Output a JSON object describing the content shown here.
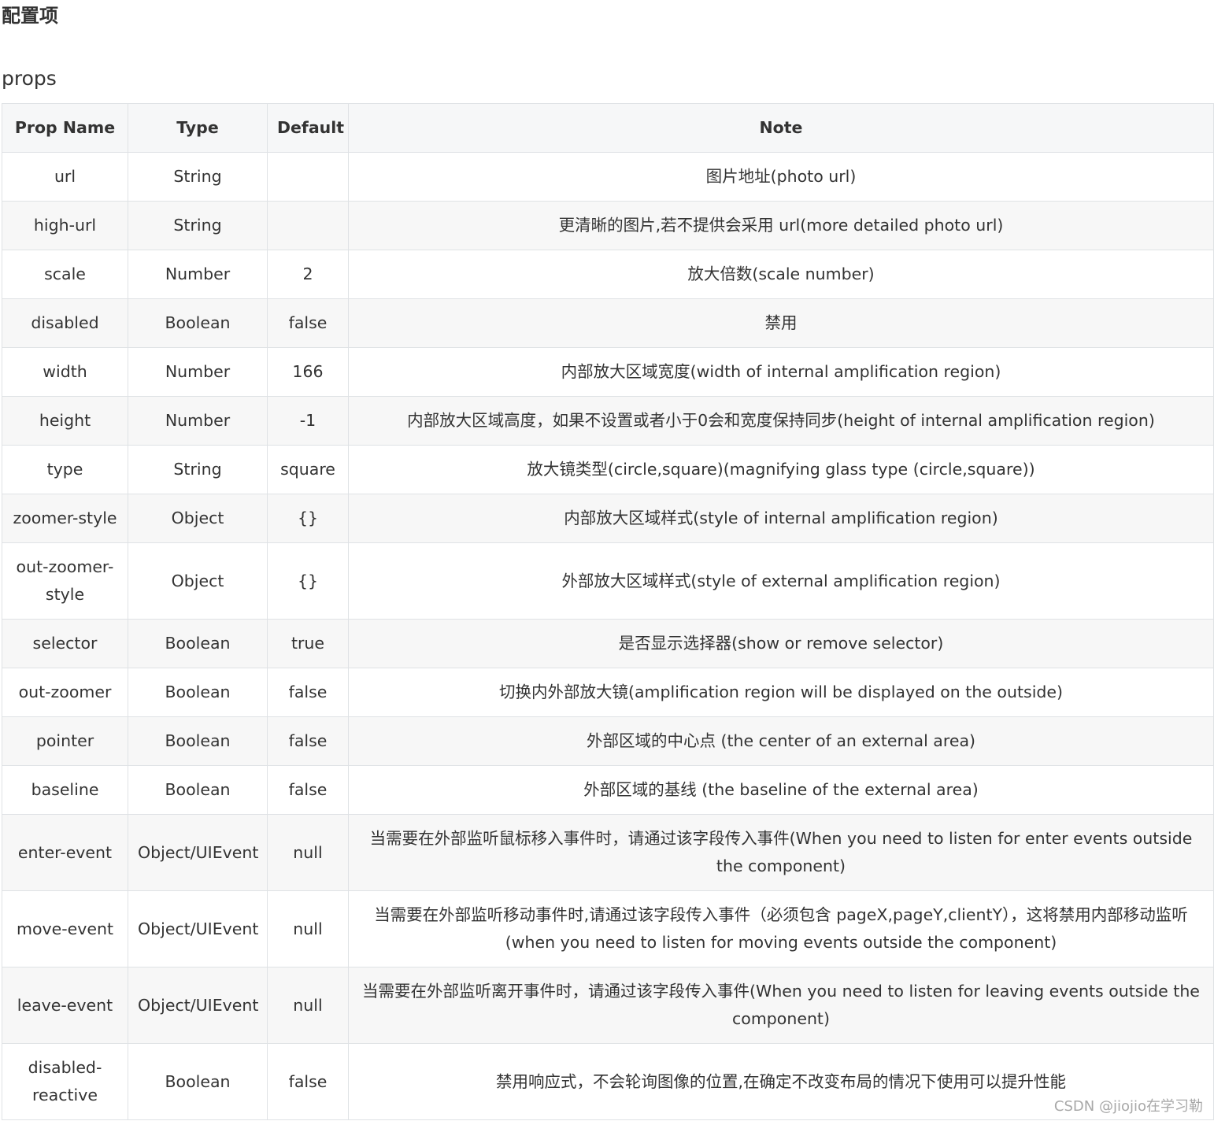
{
  "page_title": "配置项",
  "section_title": "props",
  "table": {
    "headers": [
      "Prop Name",
      "Type",
      "Default",
      "Note"
    ],
    "rows": [
      [
        "url",
        "String",
        "",
        "图片地址(photo url)"
      ],
      [
        "high-url",
        "String",
        "",
        "更清晰的图片,若不提供会采用 url(more detailed photo url)"
      ],
      [
        "scale",
        "Number",
        "2",
        "放大倍数(scale number)"
      ],
      [
        "disabled",
        "Boolean",
        "false",
        "禁用"
      ],
      [
        "width",
        "Number",
        "166",
        "内部放大区域宽度(width of internal amplification region)"
      ],
      [
        "height",
        "Number",
        "-1",
        "内部放大区域高度，如果不设置或者小于0会和宽度保持同步(height of internal amplification region)"
      ],
      [
        "type",
        "String",
        "square",
        "放大镜类型(circle,square)(magnifying glass type (circle,square))"
      ],
      [
        "zoomer-style",
        "Object",
        "{}",
        "内部放大区域样式(style of internal amplification region)"
      ],
      [
        "out-zoomer-style",
        "Object",
        "{}",
        "外部放大区域样式(style of external amplification region)"
      ],
      [
        "selector",
        "Boolean",
        "true",
        "是否显示选择器(show or remove selector)"
      ],
      [
        "out-zoomer",
        "Boolean",
        "false",
        "切换内外部放大镜(amplification region will be displayed on the outside)"
      ],
      [
        "pointer",
        "Boolean",
        "false",
        "外部区域的中心点 (the center of an external area)"
      ],
      [
        "baseline",
        "Boolean",
        "false",
        "外部区域的基线 (the baseline of the external area)"
      ],
      [
        "enter-event",
        "Object/UIEvent",
        "null",
        "当需要在外部监听鼠标移入事件时，请通过该字段传入事件(When you need to listen for enter events outside the component)"
      ],
      [
        "move-event",
        "Object/UIEvent",
        "null",
        "当需要在外部监听移动事件时,请通过该字段传入事件（必须包含 pageX,pageY,clientY），这将禁用内部移动监听(when you need to listen for moving events outside the component)"
      ],
      [
        "leave-event",
        "Object/UIEvent",
        "null",
        "当需要在外部监听离开事件时，请通过该字段传入事件(When you need to listen for leaving events outside the component)"
      ],
      [
        "disabled-reactive",
        "Boolean",
        "false",
        "禁用响应式，不会轮询图像的位置,在确定不改变布局的情况下使用可以提升性能"
      ]
    ]
  },
  "watermark": "CSDN @jiojio在学习勒"
}
